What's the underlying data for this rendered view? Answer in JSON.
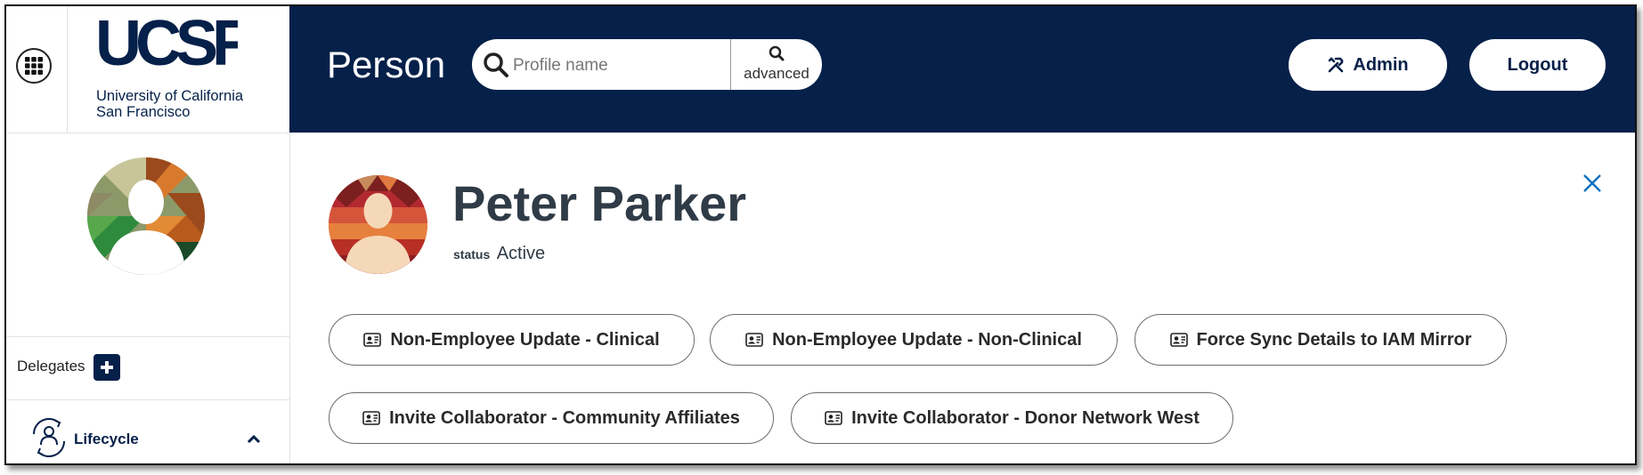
{
  "branding": {
    "logo_text": "UCSF",
    "subtitle_line1": "University of California",
    "subtitle_line2": "San Francisco"
  },
  "header": {
    "title": "Person",
    "search": {
      "placeholder": "Profile name",
      "value": "",
      "advanced_label": "advanced"
    },
    "admin_label": "Admin",
    "logout_label": "Logout"
  },
  "sidebar": {
    "delegates_label": "Delegates",
    "lifecycle_label": "Lifecycle"
  },
  "person": {
    "name": "Peter Parker",
    "status_key": "status",
    "status_value": "Active"
  },
  "actions": [
    {
      "label": "Non-Employee Update - Clinical"
    },
    {
      "label": "Non-Employee Update - Non-Clinical"
    },
    {
      "label": "Force Sync Details to IAM Mirror"
    },
    {
      "label": "Invite Collaborator - Community Affiliates"
    },
    {
      "label": "Invite Collaborator - Donor Network West"
    }
  ],
  "colors": {
    "header_bg": "#052049",
    "brand_navy": "#052049",
    "name_text": "#2f3b46",
    "close_blue": "#0b6fbf"
  },
  "icons": {
    "apps": "grid-icon",
    "search": "search-icon",
    "admin": "tools-icon",
    "action": "contact-card-icon",
    "close": "close-icon",
    "delegates_add": "plus-icon",
    "lifecycle": "lifecycle-icon",
    "lifecycle_toggle": "chevron-up-icon"
  }
}
